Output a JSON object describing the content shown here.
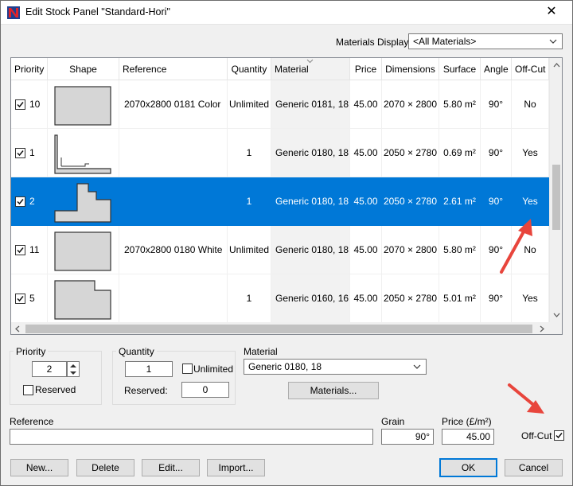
{
  "window": {
    "title": "Edit Stock Panel \"Standard-Hori\"",
    "close": "✕"
  },
  "materials_display": {
    "label": "Materials Display",
    "value": "<All Materials>"
  },
  "grid": {
    "headers": {
      "priority": "Priority",
      "shape": "Shape",
      "reference": "Reference",
      "quantity": "Quantity",
      "material": "Material",
      "price": "Price",
      "dimensions": "Dimensions",
      "surface": "Surface",
      "angle": "Angle",
      "offcut": "Off-Cut"
    },
    "rows": [
      {
        "checked": true,
        "priority": "10",
        "shape": "rect",
        "reference": "2070x2800 0181 Color",
        "quantity": "Unlimited",
        "material": "Generic 0181, 18",
        "price": "45.00",
        "dimensions": "2070 × 2800",
        "surface": "5.80 m²",
        "angle": "90°",
        "offcut": "No",
        "selected": false
      },
      {
        "checked": true,
        "priority": "1",
        "shape": "lshape",
        "reference": "",
        "quantity": "1",
        "material": "Generic 0180, 18",
        "price": "45.00",
        "dimensions": "2050 × 2780",
        "surface": "0.69 m²",
        "angle": "90°",
        "offcut": "Yes",
        "selected": false
      },
      {
        "checked": true,
        "priority": "2",
        "shape": "step",
        "reference": "",
        "quantity": "1",
        "material": "Generic 0180, 18",
        "price": "45.00",
        "dimensions": "2050 × 2780",
        "surface": "2.61 m²",
        "angle": "90°",
        "offcut": "Yes",
        "selected": true
      },
      {
        "checked": true,
        "priority": "11",
        "shape": "rect",
        "reference": "2070x2800 0180 White",
        "quantity": "Unlimited",
        "material": "Generic 0180, 18",
        "price": "45.00",
        "dimensions": "2070 × 2800",
        "surface": "5.80 m²",
        "angle": "90°",
        "offcut": "No",
        "selected": false
      },
      {
        "checked": true,
        "priority": "5",
        "shape": "notch",
        "reference": "",
        "quantity": "1",
        "material": "Generic 0160, 16",
        "price": "45.00",
        "dimensions": "2050 × 2780",
        "surface": "5.01 m²",
        "angle": "90°",
        "offcut": "Yes",
        "selected": false
      }
    ]
  },
  "priority_group": {
    "label": "Priority",
    "value": "2",
    "reserved_label": "Reserved",
    "reserved_checked": false
  },
  "quantity_group": {
    "label": "Quantity",
    "value": "1",
    "unlimited_label": "Unlimited",
    "unlimited_checked": false,
    "reserved_label": "Reserved:",
    "reserved_value": "0"
  },
  "material": {
    "label": "Material",
    "value": "Generic 0180, 18",
    "button": "Materials..."
  },
  "reference": {
    "label": "Reference",
    "value": ""
  },
  "grain": {
    "label": "Grain",
    "value": "90°"
  },
  "price": {
    "label": "Price (£/m²)",
    "value": "45.00"
  },
  "offcut": {
    "label": "Off-Cut",
    "checked": true
  },
  "buttons": {
    "new": "New...",
    "delete": "Delete",
    "edit": "Edit...",
    "import": "Import...",
    "ok": "OK",
    "cancel": "Cancel"
  },
  "colors": {
    "selection": "#0078d7",
    "arrow": "#e8453c"
  }
}
